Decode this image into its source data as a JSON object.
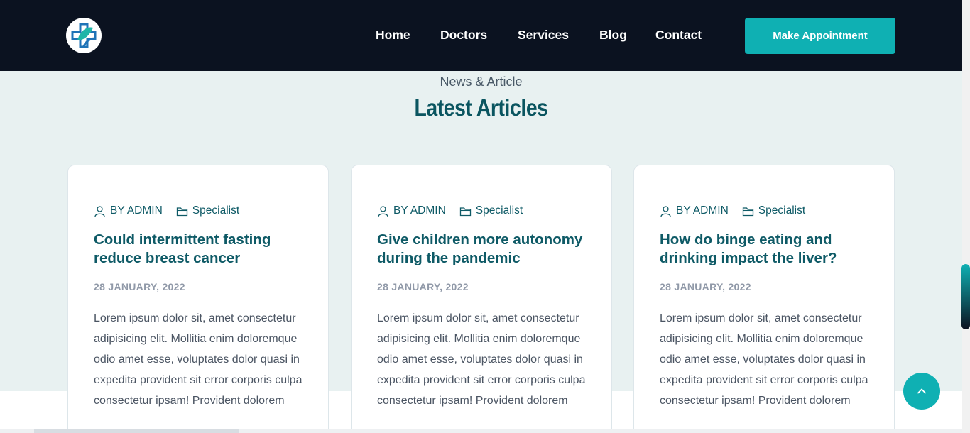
{
  "header": {
    "nav": [
      "Home",
      "Doctors",
      "Services",
      "Blog",
      "Contact"
    ],
    "cta_label": "Make Appointment"
  },
  "section": {
    "subtitle": "News & Article",
    "title": "Latest Articles"
  },
  "articles": [
    {
      "author": "BY ADMIN",
      "category": "Specialist",
      "title": "Could intermittent fasting reduce breast cancer",
      "date": "28 JANUARY, 2022",
      "excerpt": "Lorem ipsum dolor sit, amet consectetur adipisicing elit. Mollitia enim doloremque odio amet esse, voluptates dolor quasi in expedita provident sit error corporis culpa consectetur ipsam! Provident dolorem"
    },
    {
      "author": "BY ADMIN",
      "category": "Specialist",
      "title": "Give children more autonomy during the pandemic",
      "date": "28 JANUARY, 2022",
      "excerpt": "Lorem ipsum dolor sit, amet consectetur adipisicing elit. Mollitia enim doloremque odio amet esse, voluptates dolor quasi in expedita provident sit error corporis culpa consectetur ipsam! Provident dolorem"
    },
    {
      "author": "BY ADMIN",
      "category": "Specialist",
      "title": "How do binge eating and drinking impact the liver?",
      "date": "28 JANUARY, 2022",
      "excerpt": "Lorem ipsum dolor sit, amet consectetur adipisicing elit. Mollitia enim doloremque odio amet esse, voluptates dolor quasi in expedita provident sit error corporis culpa consectetur ipsam! Provident dolorem"
    }
  ],
  "icons": {
    "logo": "medical-cross-logo",
    "author": "user-icon",
    "category": "folder-icon",
    "back_to_top": "chevron-up-icon"
  },
  "colors": {
    "header_bg": "#0b1220",
    "accent": "#0fb0b3",
    "heading": "#0a5560",
    "section_bg": "#e8f1f1"
  }
}
